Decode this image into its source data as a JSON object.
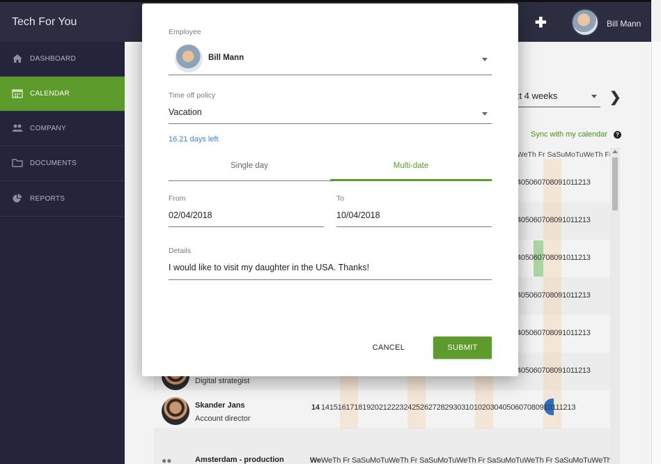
{
  "app": {
    "brand": "Tech For You",
    "user_name": "Bill Mann",
    "add_glyph": "✚"
  },
  "sidebar": {
    "items": [
      {
        "label": "DASHBOARD",
        "icon": "home-icon"
      },
      {
        "label": "CALENDAR",
        "icon": "calendar-icon",
        "active": true
      },
      {
        "label": "COMPANY",
        "icon": "people-icon"
      },
      {
        "label": "DOCUMENTS",
        "icon": "folder-icon"
      },
      {
        "label": "REPORTS",
        "icon": "pie-chart-icon"
      }
    ]
  },
  "calendar": {
    "range_label": "xt 4 weeks",
    "next_glyph": "❯",
    "sync_label": "Sync with my calendar",
    "help_glyph": "?",
    "header_days": "WeTh Fr SaSuMoTuWeTh Fr",
    "row_numbers": "405060708091011213",
    "full_row_numbers": "14151617181920212223242526272829303101020304050607080910111213",
    "today_number": "14",
    "bottom_header": "WeTh Fr SaSuMoTuWeTh Fr SaSuMoTuWeTh Fr SaSuMoTuWeTh Fr SaSuMoTuWeTh Fr",
    "bottom_header_first": "We",
    "people": [
      {
        "name": "",
        "role": "Digital strategist"
      },
      {
        "name": "Skander Jans",
        "role": "Account director"
      }
    ],
    "group_name": "Amsterdam - production"
  },
  "dialog": {
    "employee_label": "Employee",
    "employee_name": "Bill Mann",
    "policy_label": "Time off policy",
    "policy_value": "Vacation",
    "days_left": "16.21 days left",
    "tabs": {
      "single": "Single day",
      "multi": "Multi-date"
    },
    "from_label": "From",
    "from_value": "02/04/2018",
    "to_label": "To",
    "to_value": "10/04/2018",
    "details_label": "Details",
    "details_value": "I would like to visit my daughter in the USA. Thanks!",
    "cancel_label": "CANCEL",
    "submit_label": "SUBMIT"
  },
  "colors": {
    "accent": "#5c9b2c",
    "sidebar_bg": "#24243a",
    "topbar_bg": "#2d2d42",
    "link_blue": "#3f7fd1"
  }
}
